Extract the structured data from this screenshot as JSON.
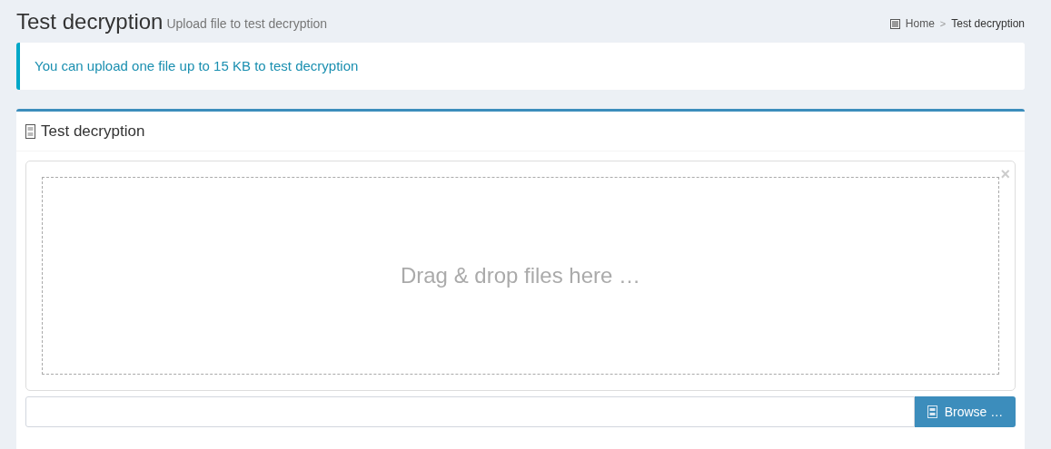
{
  "header": {
    "title": "Test decryption",
    "subtitle": "Upload file to test decryption"
  },
  "breadcrumb": [
    {
      "label": "Home",
      "selected": false
    },
    {
      "label": "Test decryption",
      "selected": true
    }
  ],
  "breadcrumb_separator": ">",
  "callout": {
    "text": "You can upload one file up to 15 KB to test decryption"
  },
  "panel": {
    "title": "Test decryption",
    "dropzone": {
      "text": "Drag & drop files here …",
      "close": "×"
    },
    "browse_button": "Browse …"
  }
}
